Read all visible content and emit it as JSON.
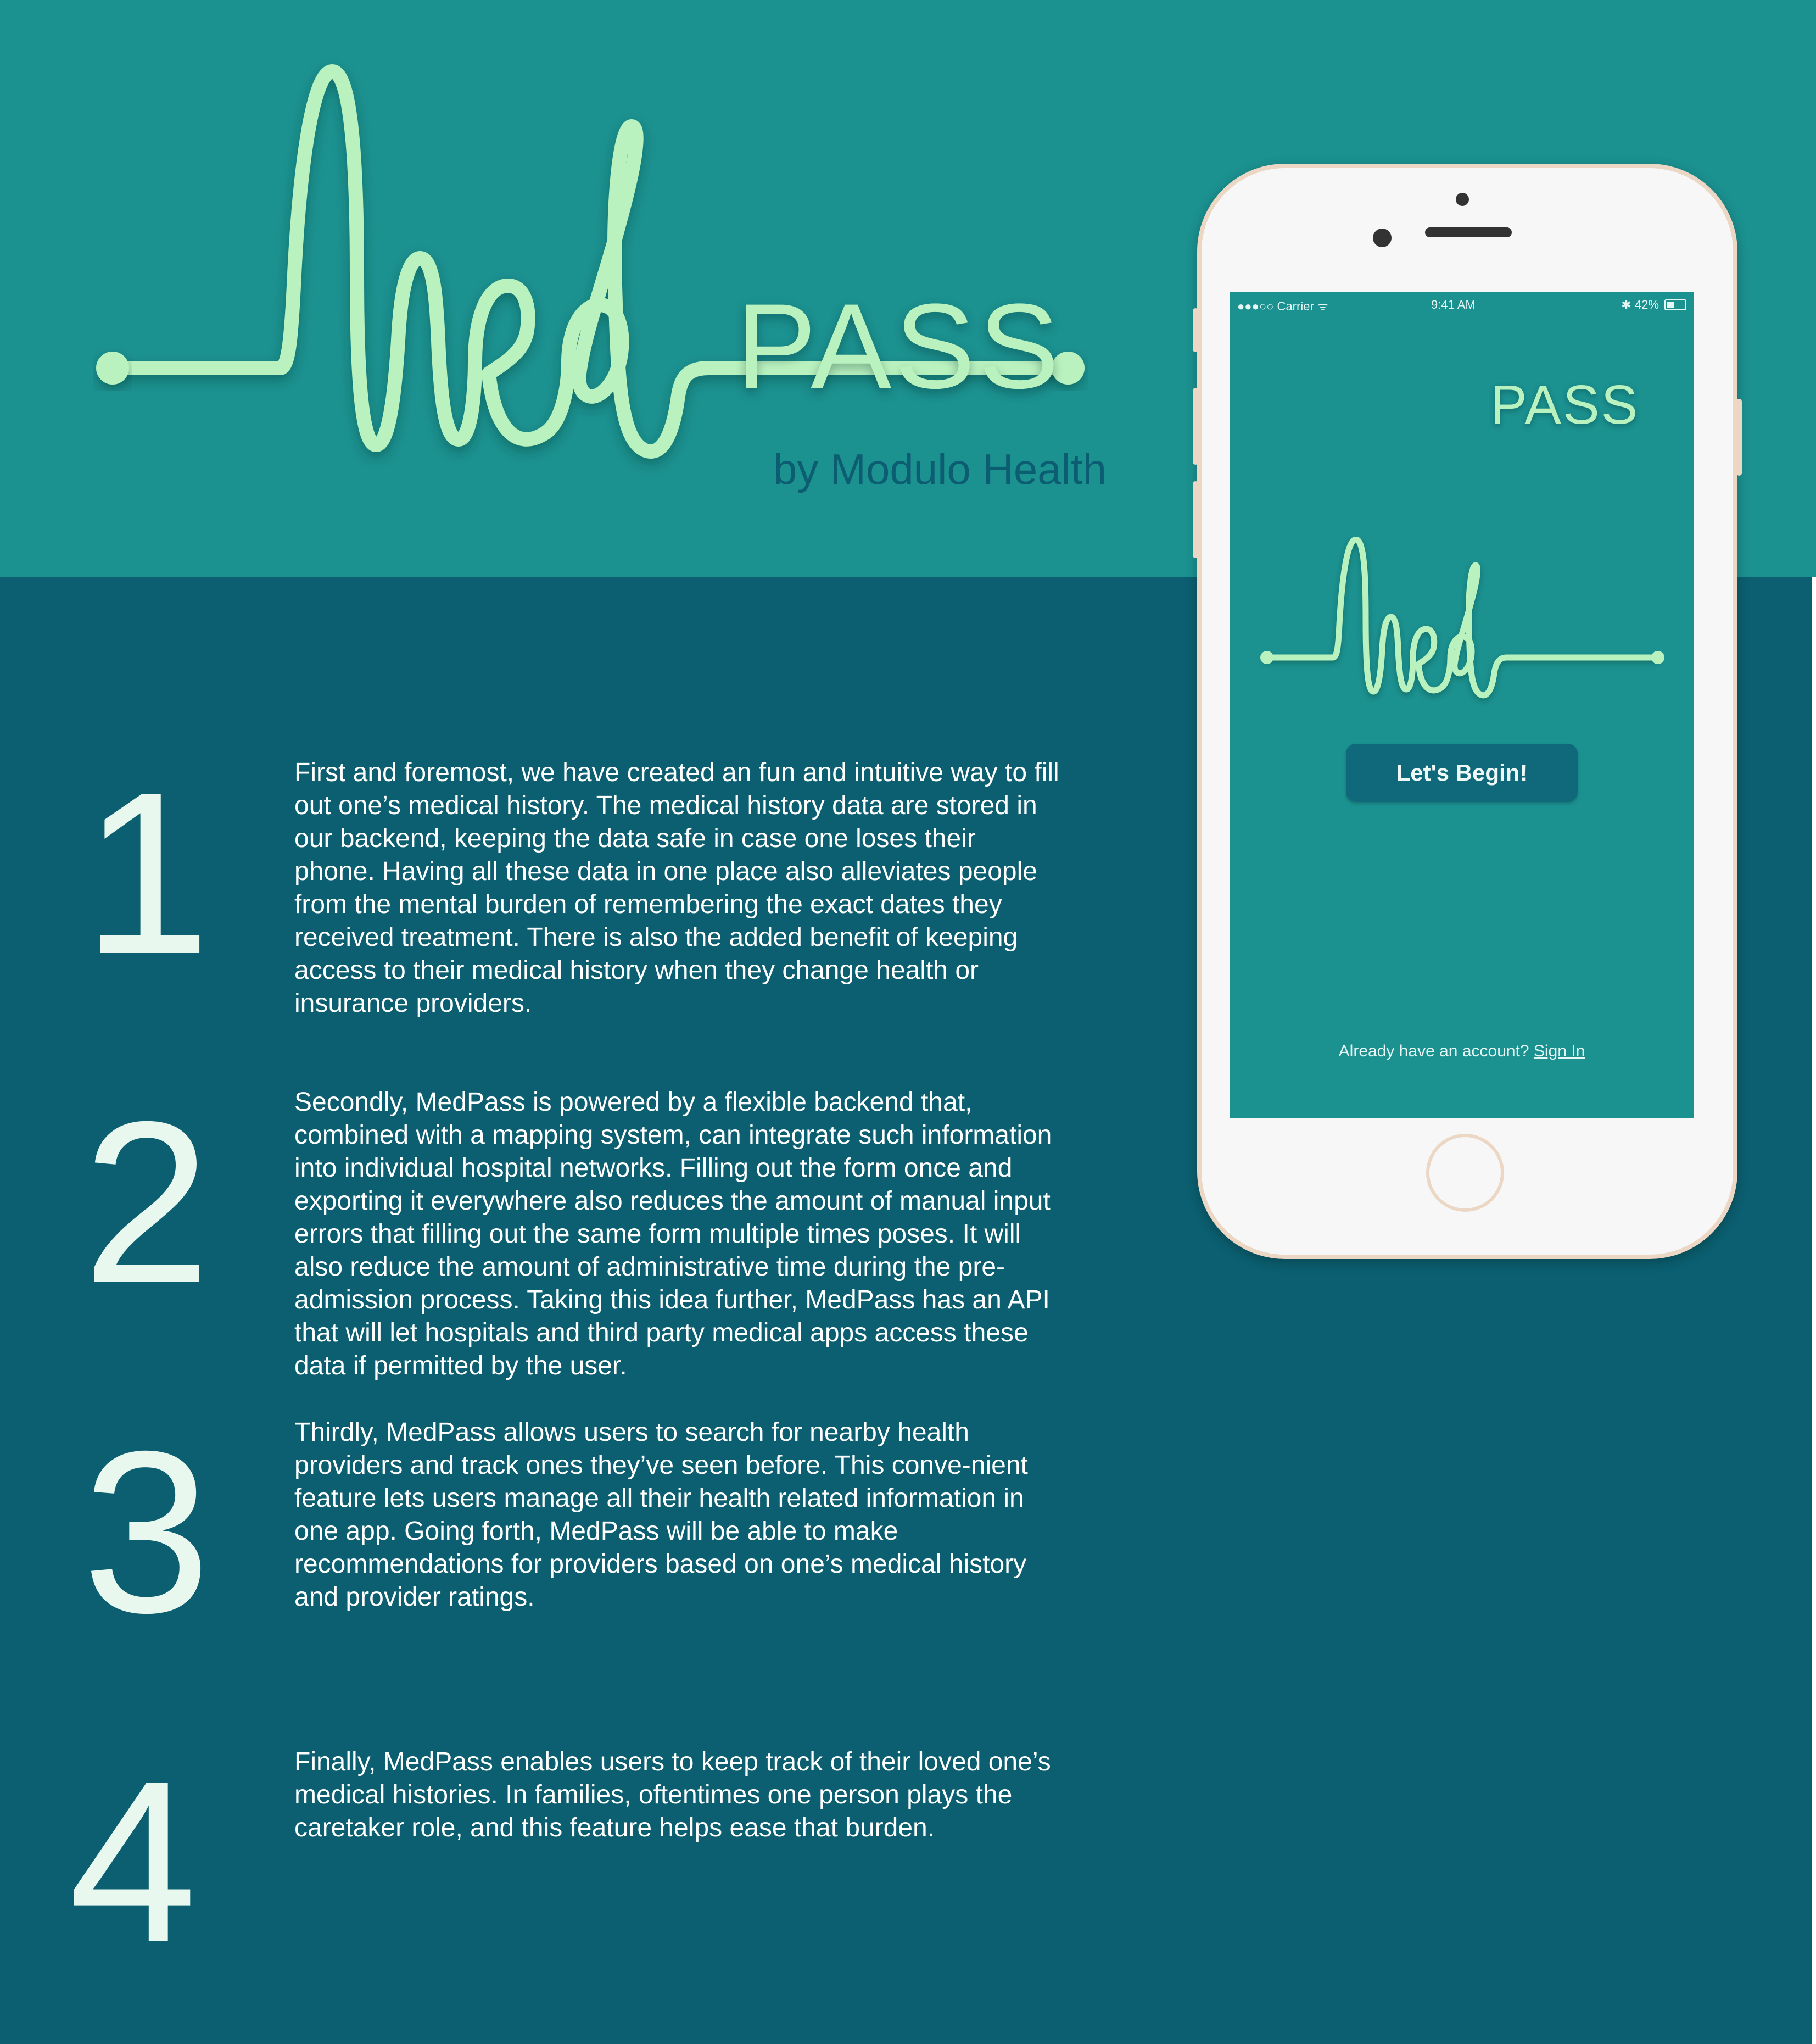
{
  "brand": {
    "logo_word": "PASS",
    "byline": "by Modulo Health"
  },
  "phone": {
    "status_left": "●●●○○ Carrier ᯤ",
    "status_time": "9:41 AM",
    "status_right": "✱ 42%",
    "battery_percent": 42,
    "logo_word": "PASS",
    "begin_label": "Let's Begin!",
    "account_prompt": "Already have an account?",
    "signin_label": "Sign In"
  },
  "features": [
    {
      "number": "1",
      "text": "First and foremost, we have created an fun and intuitive way to fill out one’s medical history. The medical history data are stored in our backend, keeping the data safe in case one loses their phone. Having all these data in one place also alleviates people from the mental burden of remembering the exact dates they received treatment. There is also the added benefit of keeping access to their medical history when they change health or insurance providers."
    },
    {
      "number": "2",
      "text": "Secondly, MedPass is powered by a flexible backend that, combined with a mapping system, can integrate such information into individual hospital networks. Filling out the form once and exporting it everywhere also reduces the amount of manual input errors that filling out the same form multiple times poses. It will also reduce the amount of administrative time during the pre-admission process. Taking this idea further, MedPass has an API that will let hospitals and third party medical apps access these data if permitted by the user."
    },
    {
      "number": "3",
      "text": "Thirdly, MedPass allows users to search for nearby health providers and track ones they’ve seen before. This conve-nient feature lets users manage all their health related information in one app. Going forth, MedPass will be able to make recommendations for providers based on one’s medical history and provider ratings."
    },
    {
      "number": "4",
      "text": "Finally, MedPass enables users to keep track of their loved one’s medical histories. In families, oftentimes one person plays the caretaker role, and this feature helps ease that burden."
    }
  ],
  "colors": {
    "top_band": "#1b9190",
    "body_background": "#0b5f70",
    "logo_green": "#b9f2bf",
    "byline_color": "#0d5d72",
    "phone_rose_gold": "#ecd6c4"
  }
}
